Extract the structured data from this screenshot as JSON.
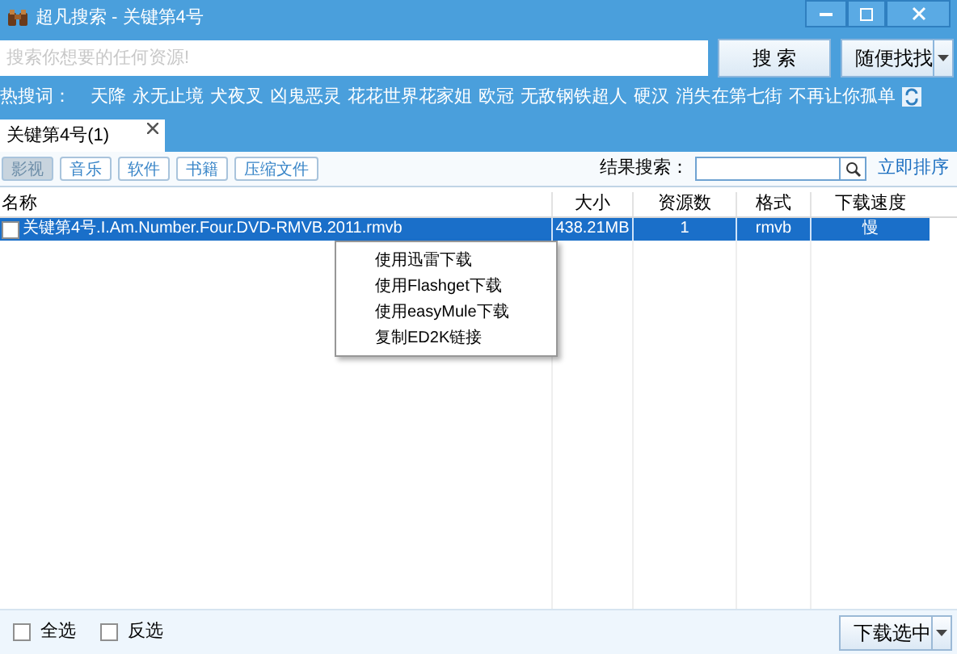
{
  "window": {
    "title": "超凡搜索 - 关键第4号"
  },
  "search": {
    "placeholder": "搜索你想要的任何资源!",
    "button": "搜 索",
    "random_button": "随便找找"
  },
  "hot_words": {
    "label": "热搜词：",
    "items": [
      "天降",
      "永无止境",
      "犬夜叉",
      "凶鬼恶灵",
      "花花世界花家姐",
      "欧冠",
      "无敌钢铁超人",
      "硬汉",
      "消失在第七街",
      "不再让你孤单"
    ]
  },
  "tabs": [
    {
      "label": "关键第4号(1)",
      "selected": true
    }
  ],
  "categories": [
    {
      "label": "影视",
      "selected": true
    },
    {
      "label": "音乐",
      "selected": false
    },
    {
      "label": "软件",
      "selected": false
    },
    {
      "label": "书籍",
      "selected": false
    },
    {
      "label": "压缩文件",
      "selected": false
    }
  ],
  "result_search": {
    "label": "结果搜索：",
    "sort_link": "立即排序"
  },
  "table": {
    "columns": [
      "名称",
      "大小",
      "资源数",
      "格式",
      "下载速度"
    ],
    "rows": [
      {
        "name": "关键第4号.I.Am.Number.Four.DVD-RMVB.2011.rmvb",
        "size": "438.21MB",
        "sources": "1",
        "format": "rmvb",
        "speed": "慢",
        "checked": false,
        "selected": true
      }
    ]
  },
  "context_menu": [
    "使用迅雷下载",
    "使用Flashget下载",
    "使用easyMule下载",
    "复制ED2K链接"
  ],
  "footer": {
    "select_all": {
      "label": "全选",
      "checked": false
    },
    "invert": {
      "label": "反选",
      "checked": false
    },
    "download_button": "下载选中"
  }
}
